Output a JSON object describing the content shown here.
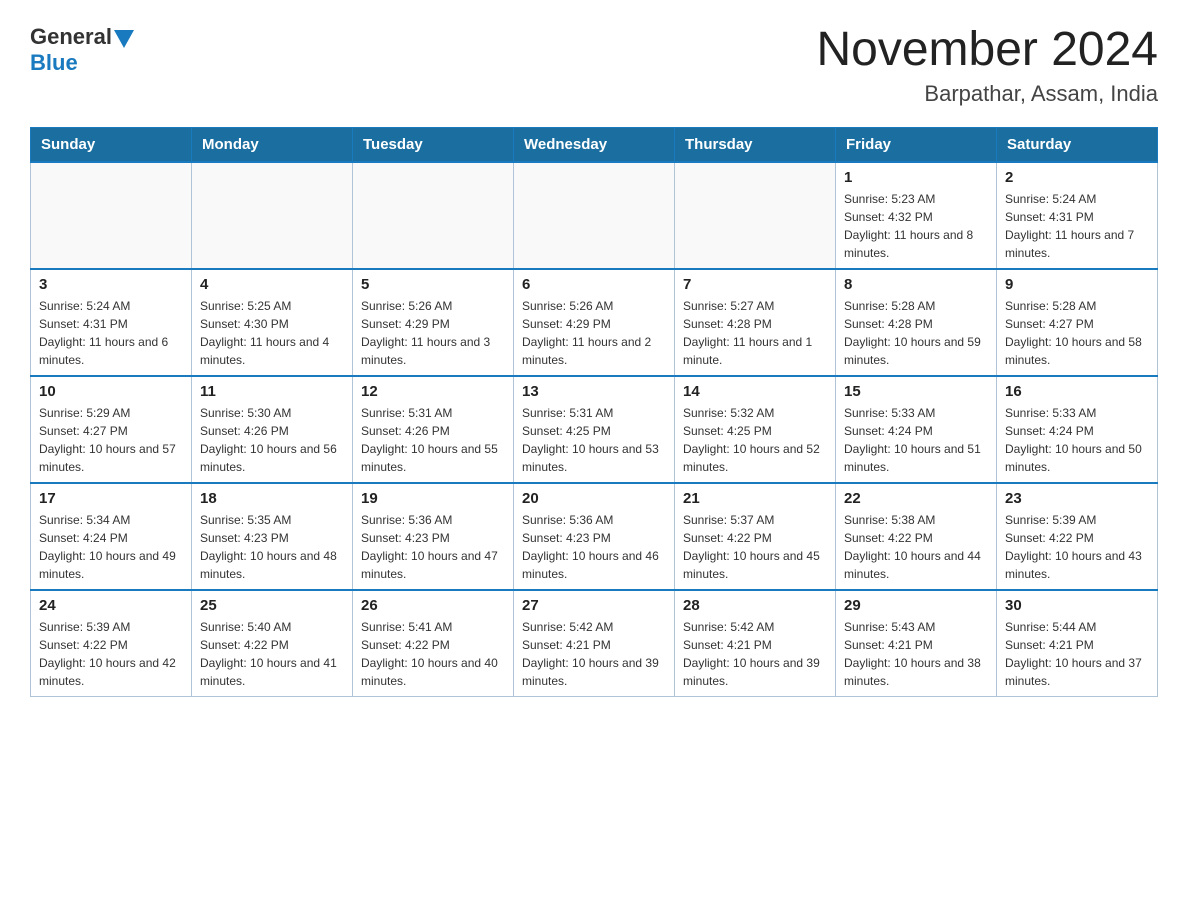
{
  "logo": {
    "general": "General",
    "blue": "Blue"
  },
  "title": "November 2024",
  "subtitle": "Barpathar, Assam, India",
  "days_of_week": [
    "Sunday",
    "Monday",
    "Tuesday",
    "Wednesday",
    "Thursday",
    "Friday",
    "Saturday"
  ],
  "weeks": [
    [
      {
        "day": "",
        "info": ""
      },
      {
        "day": "",
        "info": ""
      },
      {
        "day": "",
        "info": ""
      },
      {
        "day": "",
        "info": ""
      },
      {
        "day": "",
        "info": ""
      },
      {
        "day": "1",
        "info": "Sunrise: 5:23 AM\nSunset: 4:32 PM\nDaylight: 11 hours and 8 minutes."
      },
      {
        "day": "2",
        "info": "Sunrise: 5:24 AM\nSunset: 4:31 PM\nDaylight: 11 hours and 7 minutes."
      }
    ],
    [
      {
        "day": "3",
        "info": "Sunrise: 5:24 AM\nSunset: 4:31 PM\nDaylight: 11 hours and 6 minutes."
      },
      {
        "day": "4",
        "info": "Sunrise: 5:25 AM\nSunset: 4:30 PM\nDaylight: 11 hours and 4 minutes."
      },
      {
        "day": "5",
        "info": "Sunrise: 5:26 AM\nSunset: 4:29 PM\nDaylight: 11 hours and 3 minutes."
      },
      {
        "day": "6",
        "info": "Sunrise: 5:26 AM\nSunset: 4:29 PM\nDaylight: 11 hours and 2 minutes."
      },
      {
        "day": "7",
        "info": "Sunrise: 5:27 AM\nSunset: 4:28 PM\nDaylight: 11 hours and 1 minute."
      },
      {
        "day": "8",
        "info": "Sunrise: 5:28 AM\nSunset: 4:28 PM\nDaylight: 10 hours and 59 minutes."
      },
      {
        "day": "9",
        "info": "Sunrise: 5:28 AM\nSunset: 4:27 PM\nDaylight: 10 hours and 58 minutes."
      }
    ],
    [
      {
        "day": "10",
        "info": "Sunrise: 5:29 AM\nSunset: 4:27 PM\nDaylight: 10 hours and 57 minutes."
      },
      {
        "day": "11",
        "info": "Sunrise: 5:30 AM\nSunset: 4:26 PM\nDaylight: 10 hours and 56 minutes."
      },
      {
        "day": "12",
        "info": "Sunrise: 5:31 AM\nSunset: 4:26 PM\nDaylight: 10 hours and 55 minutes."
      },
      {
        "day": "13",
        "info": "Sunrise: 5:31 AM\nSunset: 4:25 PM\nDaylight: 10 hours and 53 minutes."
      },
      {
        "day": "14",
        "info": "Sunrise: 5:32 AM\nSunset: 4:25 PM\nDaylight: 10 hours and 52 minutes."
      },
      {
        "day": "15",
        "info": "Sunrise: 5:33 AM\nSunset: 4:24 PM\nDaylight: 10 hours and 51 minutes."
      },
      {
        "day": "16",
        "info": "Sunrise: 5:33 AM\nSunset: 4:24 PM\nDaylight: 10 hours and 50 minutes."
      }
    ],
    [
      {
        "day": "17",
        "info": "Sunrise: 5:34 AM\nSunset: 4:24 PM\nDaylight: 10 hours and 49 minutes."
      },
      {
        "day": "18",
        "info": "Sunrise: 5:35 AM\nSunset: 4:23 PM\nDaylight: 10 hours and 48 minutes."
      },
      {
        "day": "19",
        "info": "Sunrise: 5:36 AM\nSunset: 4:23 PM\nDaylight: 10 hours and 47 minutes."
      },
      {
        "day": "20",
        "info": "Sunrise: 5:36 AM\nSunset: 4:23 PM\nDaylight: 10 hours and 46 minutes."
      },
      {
        "day": "21",
        "info": "Sunrise: 5:37 AM\nSunset: 4:22 PM\nDaylight: 10 hours and 45 minutes."
      },
      {
        "day": "22",
        "info": "Sunrise: 5:38 AM\nSunset: 4:22 PM\nDaylight: 10 hours and 44 minutes."
      },
      {
        "day": "23",
        "info": "Sunrise: 5:39 AM\nSunset: 4:22 PM\nDaylight: 10 hours and 43 minutes."
      }
    ],
    [
      {
        "day": "24",
        "info": "Sunrise: 5:39 AM\nSunset: 4:22 PM\nDaylight: 10 hours and 42 minutes."
      },
      {
        "day": "25",
        "info": "Sunrise: 5:40 AM\nSunset: 4:22 PM\nDaylight: 10 hours and 41 minutes."
      },
      {
        "day": "26",
        "info": "Sunrise: 5:41 AM\nSunset: 4:22 PM\nDaylight: 10 hours and 40 minutes."
      },
      {
        "day": "27",
        "info": "Sunrise: 5:42 AM\nSunset: 4:21 PM\nDaylight: 10 hours and 39 minutes."
      },
      {
        "day": "28",
        "info": "Sunrise: 5:42 AM\nSunset: 4:21 PM\nDaylight: 10 hours and 39 minutes."
      },
      {
        "day": "29",
        "info": "Sunrise: 5:43 AM\nSunset: 4:21 PM\nDaylight: 10 hours and 38 minutes."
      },
      {
        "day": "30",
        "info": "Sunrise: 5:44 AM\nSunset: 4:21 PM\nDaylight: 10 hours and 37 minutes."
      }
    ]
  ]
}
